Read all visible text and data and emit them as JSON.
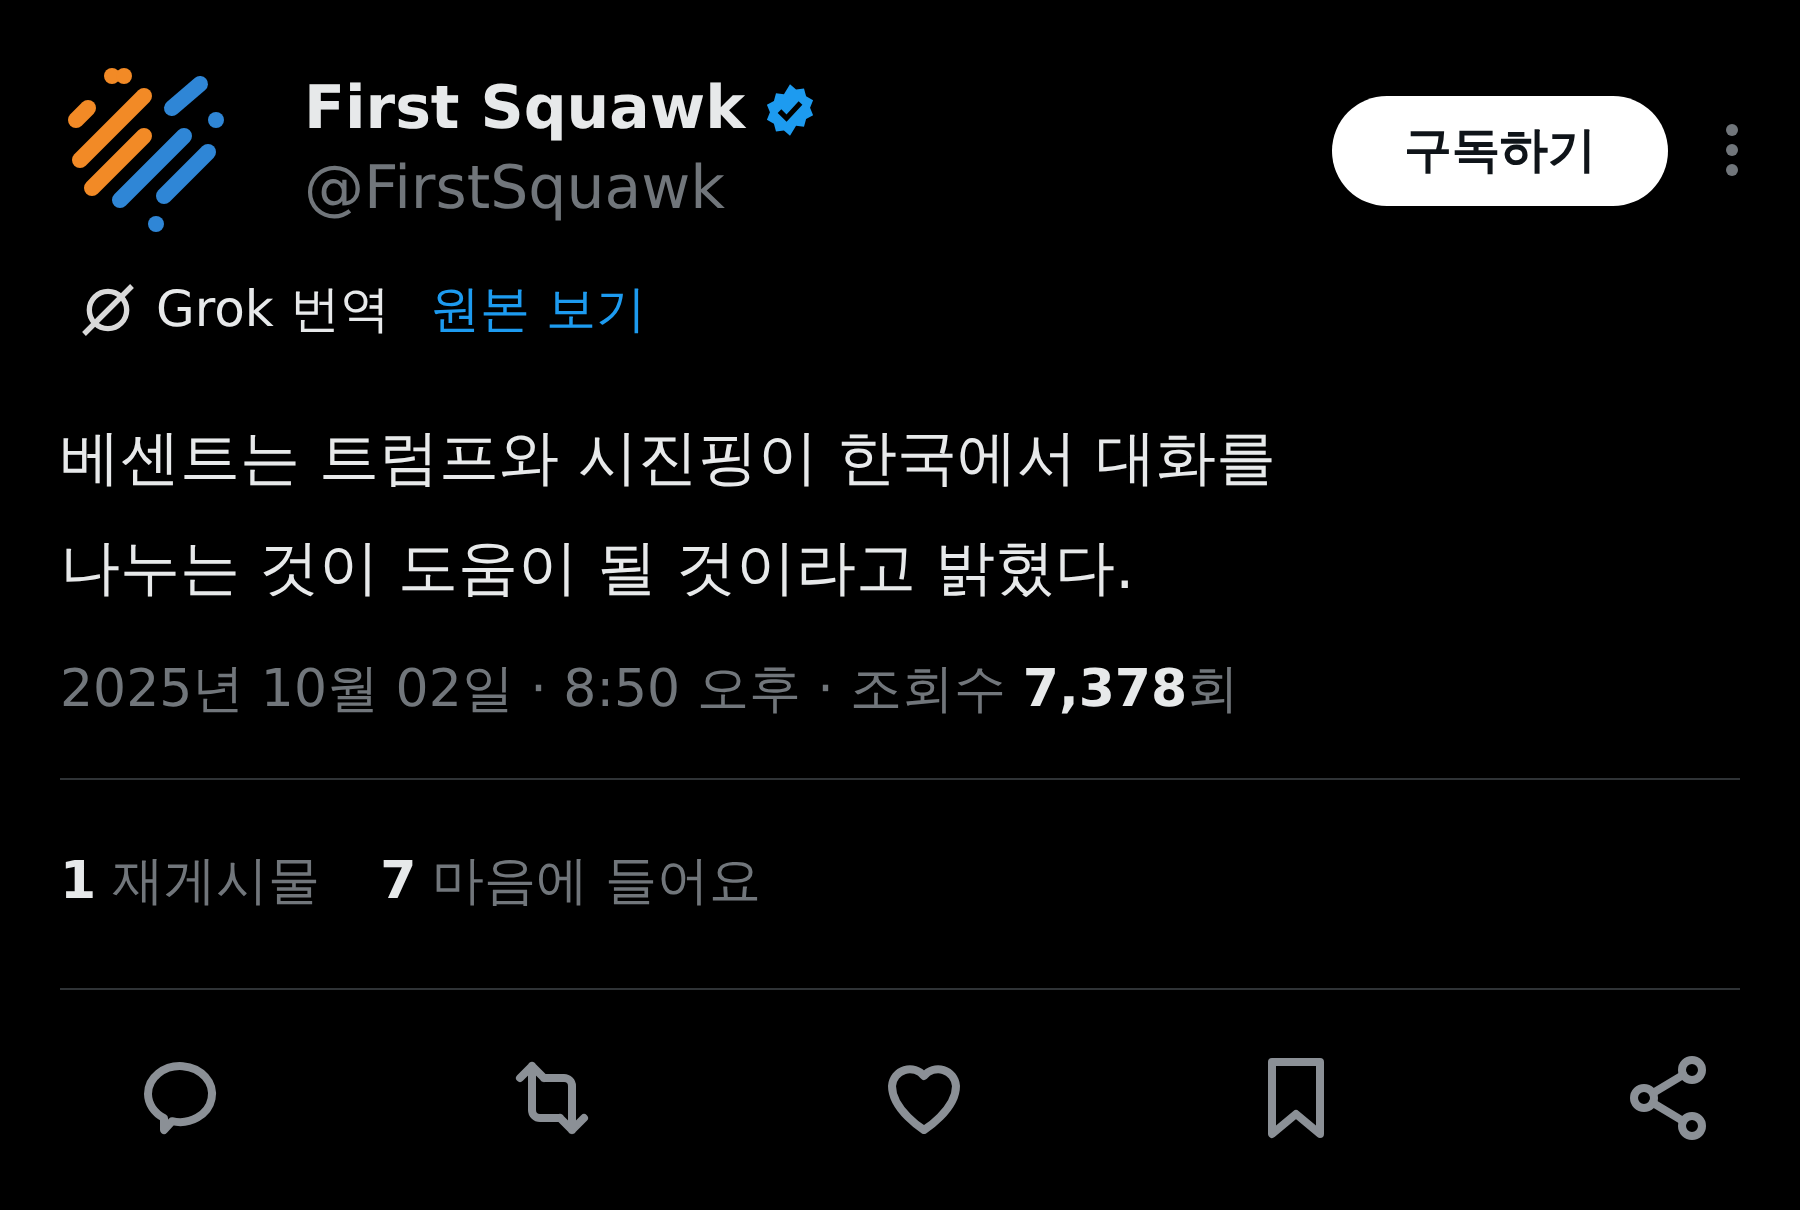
{
  "author": {
    "name": "First Squawk",
    "handle": "@FirstSquawk",
    "verified": true
  },
  "subscribe_button": "구독하기",
  "translation": {
    "label": "Grok 번역",
    "link": "원본 보기"
  },
  "body_lines": [
    "베센트는 트럼프와 시진핑이 한국에서 대화를",
    "나누는 것이 도움이 될 것이라고 밝혔다."
  ],
  "meta": "2025년 10월 02일 · 8:50 오후 · 조회수 **7,378**회",
  "stats": [
    {
      "count": "1",
      "label": "재게시물"
    },
    {
      "count": "7",
      "label": "마음에 들어요"
    }
  ],
  "actions": [
    {
      "kind": "reply"
    },
    {
      "kind": "repost"
    },
    {
      "kind": "like"
    },
    {
      "kind": "bookmark"
    },
    {
      "kind": "share"
    }
  ]
}
